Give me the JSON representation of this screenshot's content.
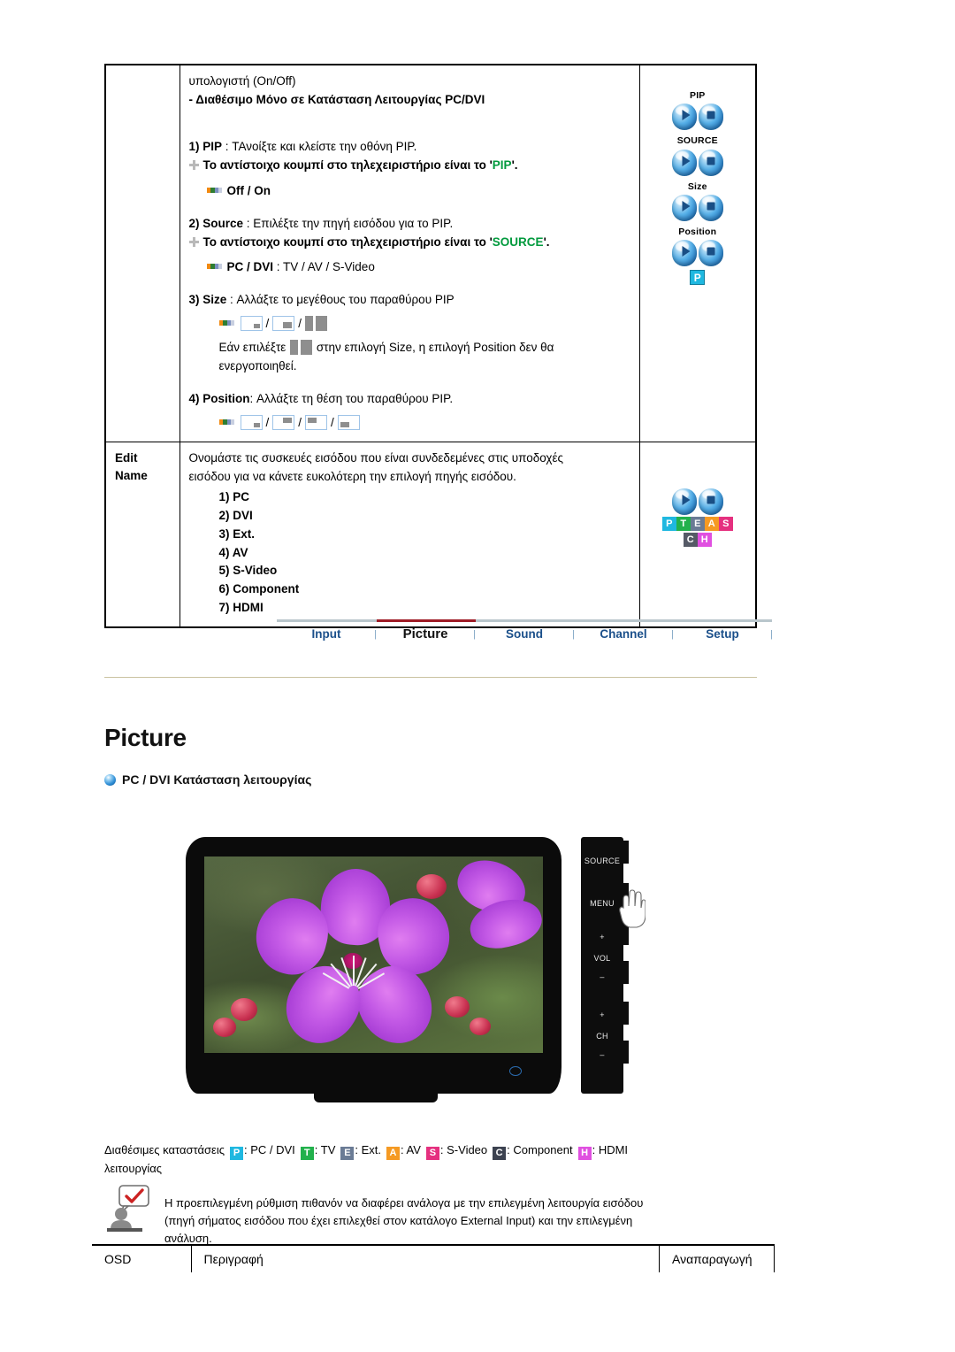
{
  "table_top": {
    "rows": [
      {
        "label": "",
        "lines": {
          "l1": "υπολογιστή (On/Off)",
          "l2": "- Διαθέσιμο Μόνο σε Κατάσταση Λειτουργίας PC/DVI",
          "item1_num": "1) PIP",
          "item1_sep": " : ",
          "item1_desc": "ΤΑνοίξτε και κλείστε την οθόνη PIP.",
          "item1_remote_pre": "Το αντίστοιχο κουμπί στο τηλεχειριστήριο είναι το '",
          "item1_remote_key": "PIP",
          "item1_remote_post": "'.",
          "item1_values": "Off / On",
          "item2_num": "2) Source",
          "item2_sep": " : ",
          "item2_desc": "Επιλέξτε την πηγή εισόδου για το PIP.",
          "item2_remote_pre": "Το αντίστοιχο κουμπί στο τηλεχειριστήριο είναι το '",
          "item2_remote_key": "SOURCE",
          "item2_remote_post": "'.",
          "item2_values_b": "PC / DVI",
          "item2_values_rest": " : TV / AV / S-Video",
          "item3_num": "3) Size",
          "item3_sep": " : ",
          "item3_desc": "Αλλάξτε το μεγέθους του παραθύρου PIP",
          "item3_note_pre": "Εάν επιλέξτε ",
          "item3_note_post": " στην επιλογή Size, η επιλογή Position δεν θα ενεργοποιηθεί.",
          "item4_num": "4) Position",
          "item4_sep": ": ",
          "item4_desc": "Αλλάξτε τη θέση του παραθύρου PIP."
        },
        "remote_groups": [
          {
            "caption": "PIP"
          },
          {
            "caption": "SOURCE"
          },
          {
            "caption": "Size"
          },
          {
            "caption": "Position"
          }
        ],
        "remote_badge": "P"
      },
      {
        "label_l1": "Edit",
        "label_l2": "Name",
        "desc_l1": "Ονομάστε τις συσκευές εισόδου που είναι συνδεδεμένες στις υποδοχές",
        "desc_l2": "εισόδου για να κάνετε ευκολότερη την επιλογή πηγής εισόδου.",
        "items": [
          "1) PC",
          "2) DVI",
          "3) Ext.",
          "4) AV",
          "5) S-Video",
          "6) Component",
          "7) HDMI"
        ],
        "badges": [
          {
            "letter": "P",
            "color": "#1fb8e0"
          },
          {
            "letter": "T",
            "color": "#22b14c"
          },
          {
            "letter": "E",
            "color": "#6a7b95"
          },
          {
            "letter": "A",
            "color": "#f59a23"
          },
          {
            "letter": "S",
            "color": "#e5307f"
          },
          {
            "letter": "C",
            "color": "#555a66"
          },
          {
            "letter": "H",
            "color": "#e050e0"
          }
        ]
      }
    ]
  },
  "nav": {
    "tabs": [
      {
        "label": "Input",
        "active": false
      },
      {
        "label": "Picture",
        "active": true
      },
      {
        "label": "Sound",
        "active": false
      },
      {
        "label": "Channel",
        "active": false
      },
      {
        "label": "Setup",
        "active": false
      }
    ],
    "separator": "|",
    "active_color": "#9e1b25",
    "link_color": "#1a4f8a"
  },
  "page": {
    "title": "Picture",
    "subheading": "PC / DVI Κατάσταση λειτουργίας"
  },
  "monitor": {
    "side_buttons": {
      "source": "SOURCE",
      "menu": "MENU",
      "vol_plus": "+",
      "vol": "VOL",
      "vol_minus": "–",
      "ch_plus": "+",
      "ch": "CH",
      "ch_minus": "–"
    }
  },
  "modes": {
    "label_l1": "Διαθέσιμες καταστάσεις",
    "label_l2": "λειτουργίας",
    "items": [
      {
        "letter": "P",
        "color": "#1fb8e0",
        "text": ": PC / DVI"
      },
      {
        "letter": "T",
        "color": "#22b14c",
        "text": ": TV"
      },
      {
        "letter": "E",
        "color": "#6a7b95",
        "text": ": Ext."
      },
      {
        "letter": "A",
        "color": "#f59a23",
        "text": ": AV"
      },
      {
        "letter": "S",
        "color": "#e5307f",
        "text": ": S-Video"
      },
      {
        "letter": "C",
        "color": "#3c4250",
        "text": ": Component"
      },
      {
        "letter": "H",
        "color": "#e050e0",
        "text": ": HDMI"
      }
    ]
  },
  "note": {
    "line1": "Η προεπιλεγμένη ρύθμιση πιθανόν να διαφέρει ανάλογα με την επιλεγμένη λειτουργία εισόδου",
    "line2": "(πηγή σήματος εισόδου που έχει επιλεχθεί στον κατάλογο External Input) και την επιλεγμένη",
    "line3": "ανάλυση."
  },
  "osd_table": {
    "col1": "OSD",
    "col2": "Περιγραφή",
    "col3": "Αναπαραγωγή"
  }
}
